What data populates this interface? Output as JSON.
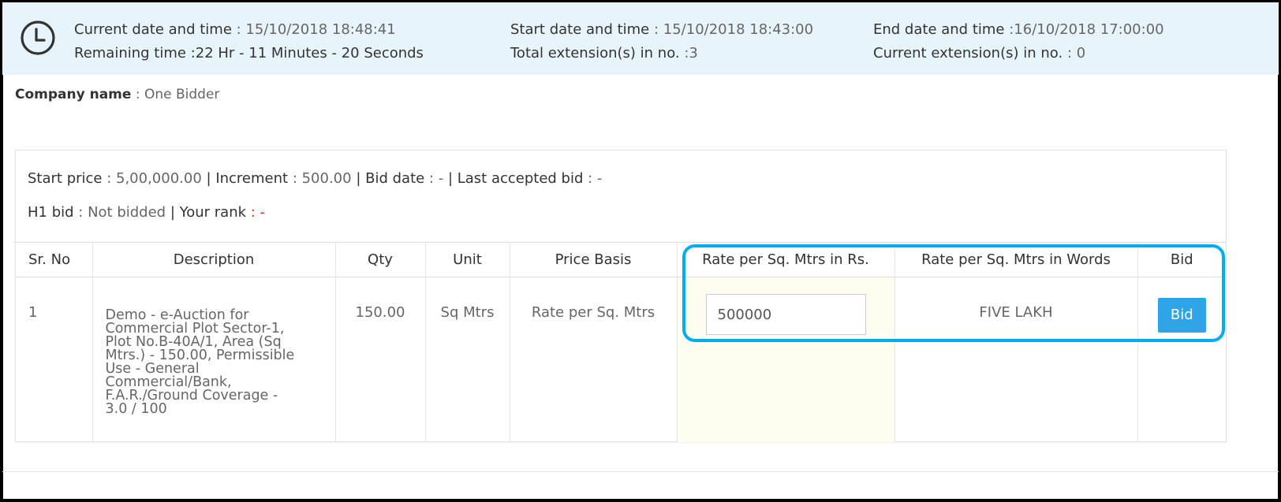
{
  "timer": {
    "current_label": "Current date and time",
    "current_value": " : 15/10/2018 18:48:41",
    "remaining_label": "Remaining time",
    "remaining_value": " :22 Hr - 11 Minutes - 20 Seconds",
    "start_label": "Start date and time",
    "start_value": " : 15/10/2018 18:43:00",
    "total_ext_label": "Total extension(s) in no.",
    "total_ext_value": " :3",
    "end_label": "End date and time",
    "end_value": " :16/10/2018 17:00:00",
    "current_ext_label": "Current extension(s) in no.",
    "current_ext_value": " : 0"
  },
  "company": {
    "label": "Company name",
    "value": " : One Bidder"
  },
  "bid_info": {
    "start_price_label": "Start price",
    "start_price_value": " : 5,00,000.00",
    "sep": " | ",
    "increment_label": "Increment",
    "increment_value": " : 500.00",
    "bid_date_label": "Bid date",
    "bid_date_value": " : -",
    "last_bid_label": "Last accepted bid",
    "last_bid_value": " :  -",
    "h1_label": "H1 bid",
    "h1_value": " : Not bidded",
    "rank_label": "Your rank",
    "rank_value": " :  -"
  },
  "table": {
    "headers": [
      "Sr. No",
      "Description",
      "Qty",
      "Unit",
      "Price Basis",
      "Rate per Sq. Mtrs in Rs.",
      "Rate per Sq. Mtrs in Words",
      "Bid"
    ],
    "row": {
      "sr_no": "1",
      "description": "Demo - e-Auction for\nCommercial Plot Sector-1,\nPlot No.B-40A/1, Area (Sq\nMtrs.) - 150.00, Permissible\nUse - General\nCommercial/Bank,\nF.A.R./Ground Coverage -\n3.0 / 100",
      "qty": "150.00",
      "unit": "Sq Mtrs",
      "price_basis": "Rate per Sq. Mtrs",
      "rate_value": "500000",
      "rate_words": "FIVE LAKH",
      "bid_label": "Bid"
    }
  },
  "colors": {
    "info_bar_bg": "#e8f4fb",
    "bid_button": "#2fa4e7",
    "highlight": "#00aeef",
    "rank_red": "#c0392b"
  },
  "icons": [
    "clock-icon"
  ]
}
